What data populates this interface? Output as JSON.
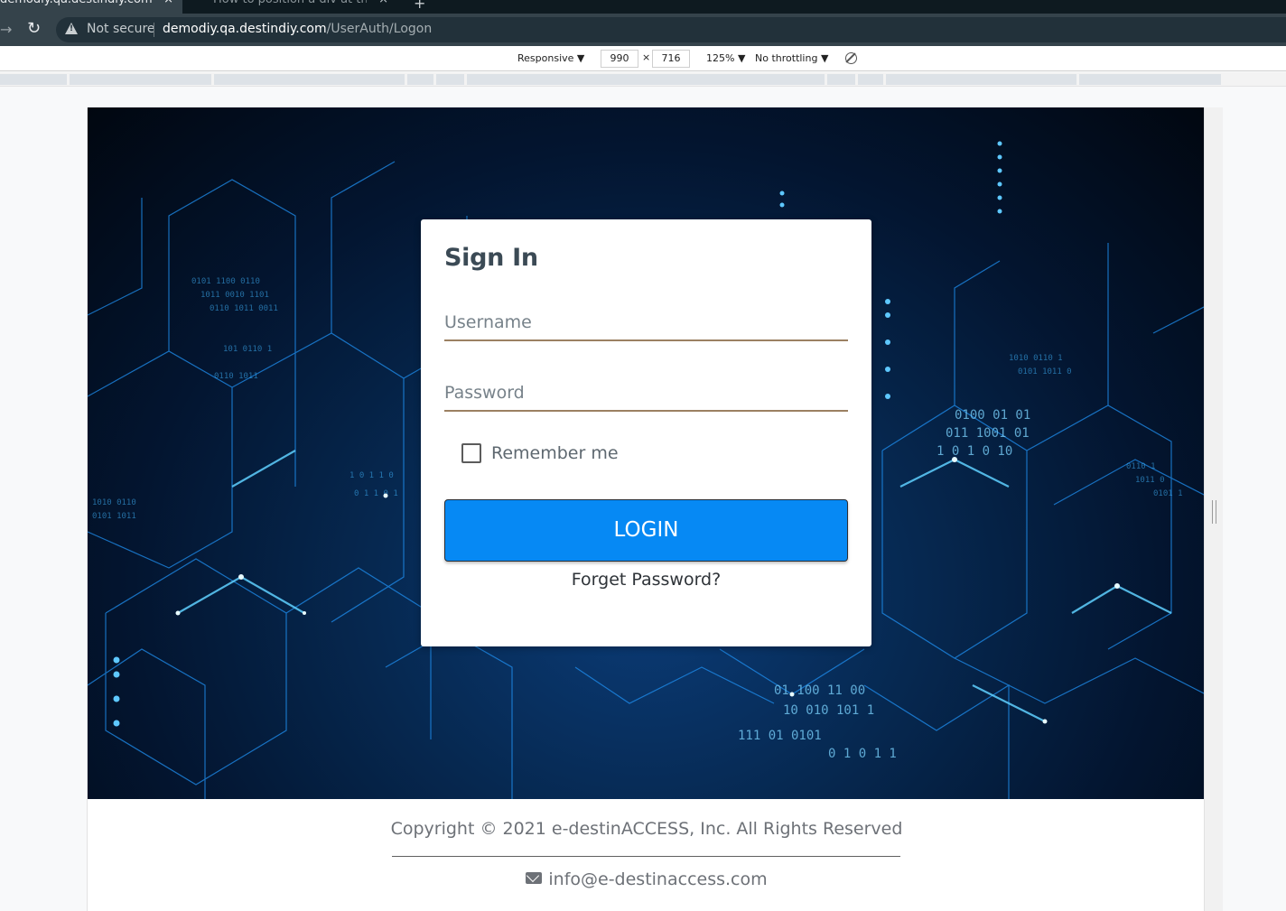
{
  "browser": {
    "tabs": [
      {
        "label": "demodiy.qa.destindiy.com",
        "active": true
      },
      {
        "label": "How to position a div at the",
        "active": false
      }
    ],
    "close_glyph": "×",
    "new_tab_glyph": "+",
    "address": {
      "security_label": "Not secure",
      "host": "demodiy.qa.destindiy.com",
      "path": "/UserAuth/Logon"
    }
  },
  "devtools": {
    "device": "Responsive ▼",
    "width": "990",
    "height": "716",
    "times": "×",
    "zoom": "125% ▼",
    "throttling": "No throttling ▼"
  },
  "signin": {
    "title": "Sign In",
    "username_placeholder": "Username",
    "password_placeholder": "Password",
    "remember_label": "Remember me",
    "remember_checked": false,
    "login_label": "LOGIN",
    "forgot_label": "Forget Password?"
  },
  "footer": {
    "copyright": "Copyright © 2021 e-destinACCESS, Inc. All Rights Reserved",
    "email": "info@e-destinaccess.com"
  },
  "colors": {
    "login_button": "#0689f4",
    "title": "#3b4a55",
    "field_underline": "#9b8062",
    "hero_dark": "#010710",
    "hero_accent": "#2fa8ff"
  }
}
